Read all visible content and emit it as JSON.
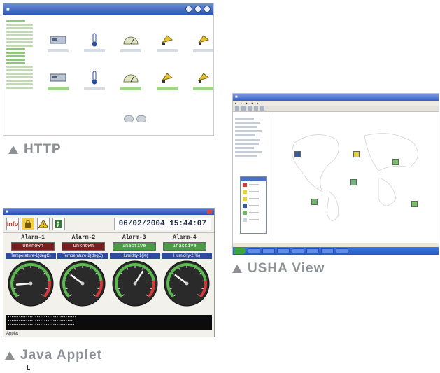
{
  "captions": {
    "http": "HTTP",
    "usha": "USHA View",
    "java": "Java Applet"
  },
  "java_applet": {
    "datetime": "06/02/2004 15:44:07",
    "toolbar_icon_label": "info",
    "alarms": [
      {
        "name": "Alarm-1",
        "status": "Unknown",
        "color": "#7a1f1f"
      },
      {
        "name": "Alarm-2",
        "status": "Unknown",
        "color": "#7a1f1f"
      },
      {
        "name": "Alarm-3",
        "status": "Inactive",
        "color": "#4c9a47"
      },
      {
        "name": "Alarm-4",
        "status": "Inactive",
        "color": "#4c9a47"
      }
    ],
    "gauges": [
      {
        "title": "Temperature-1(degC)",
        "level": 0.15
      },
      {
        "title": "Temperature-2(degC)",
        "level": 0.3
      },
      {
        "title": "Humidity-1(%)",
        "level": 0.62
      },
      {
        "title": "Humidity-2(%)",
        "level": 0.3
      }
    ],
    "status_text": "Applet"
  },
  "colors": {
    "caption_gray": "#8c9095",
    "gauge_red": "#d23a3a",
    "gauge_green": "#5bb94f",
    "title_blue": "#2c4d9e"
  }
}
